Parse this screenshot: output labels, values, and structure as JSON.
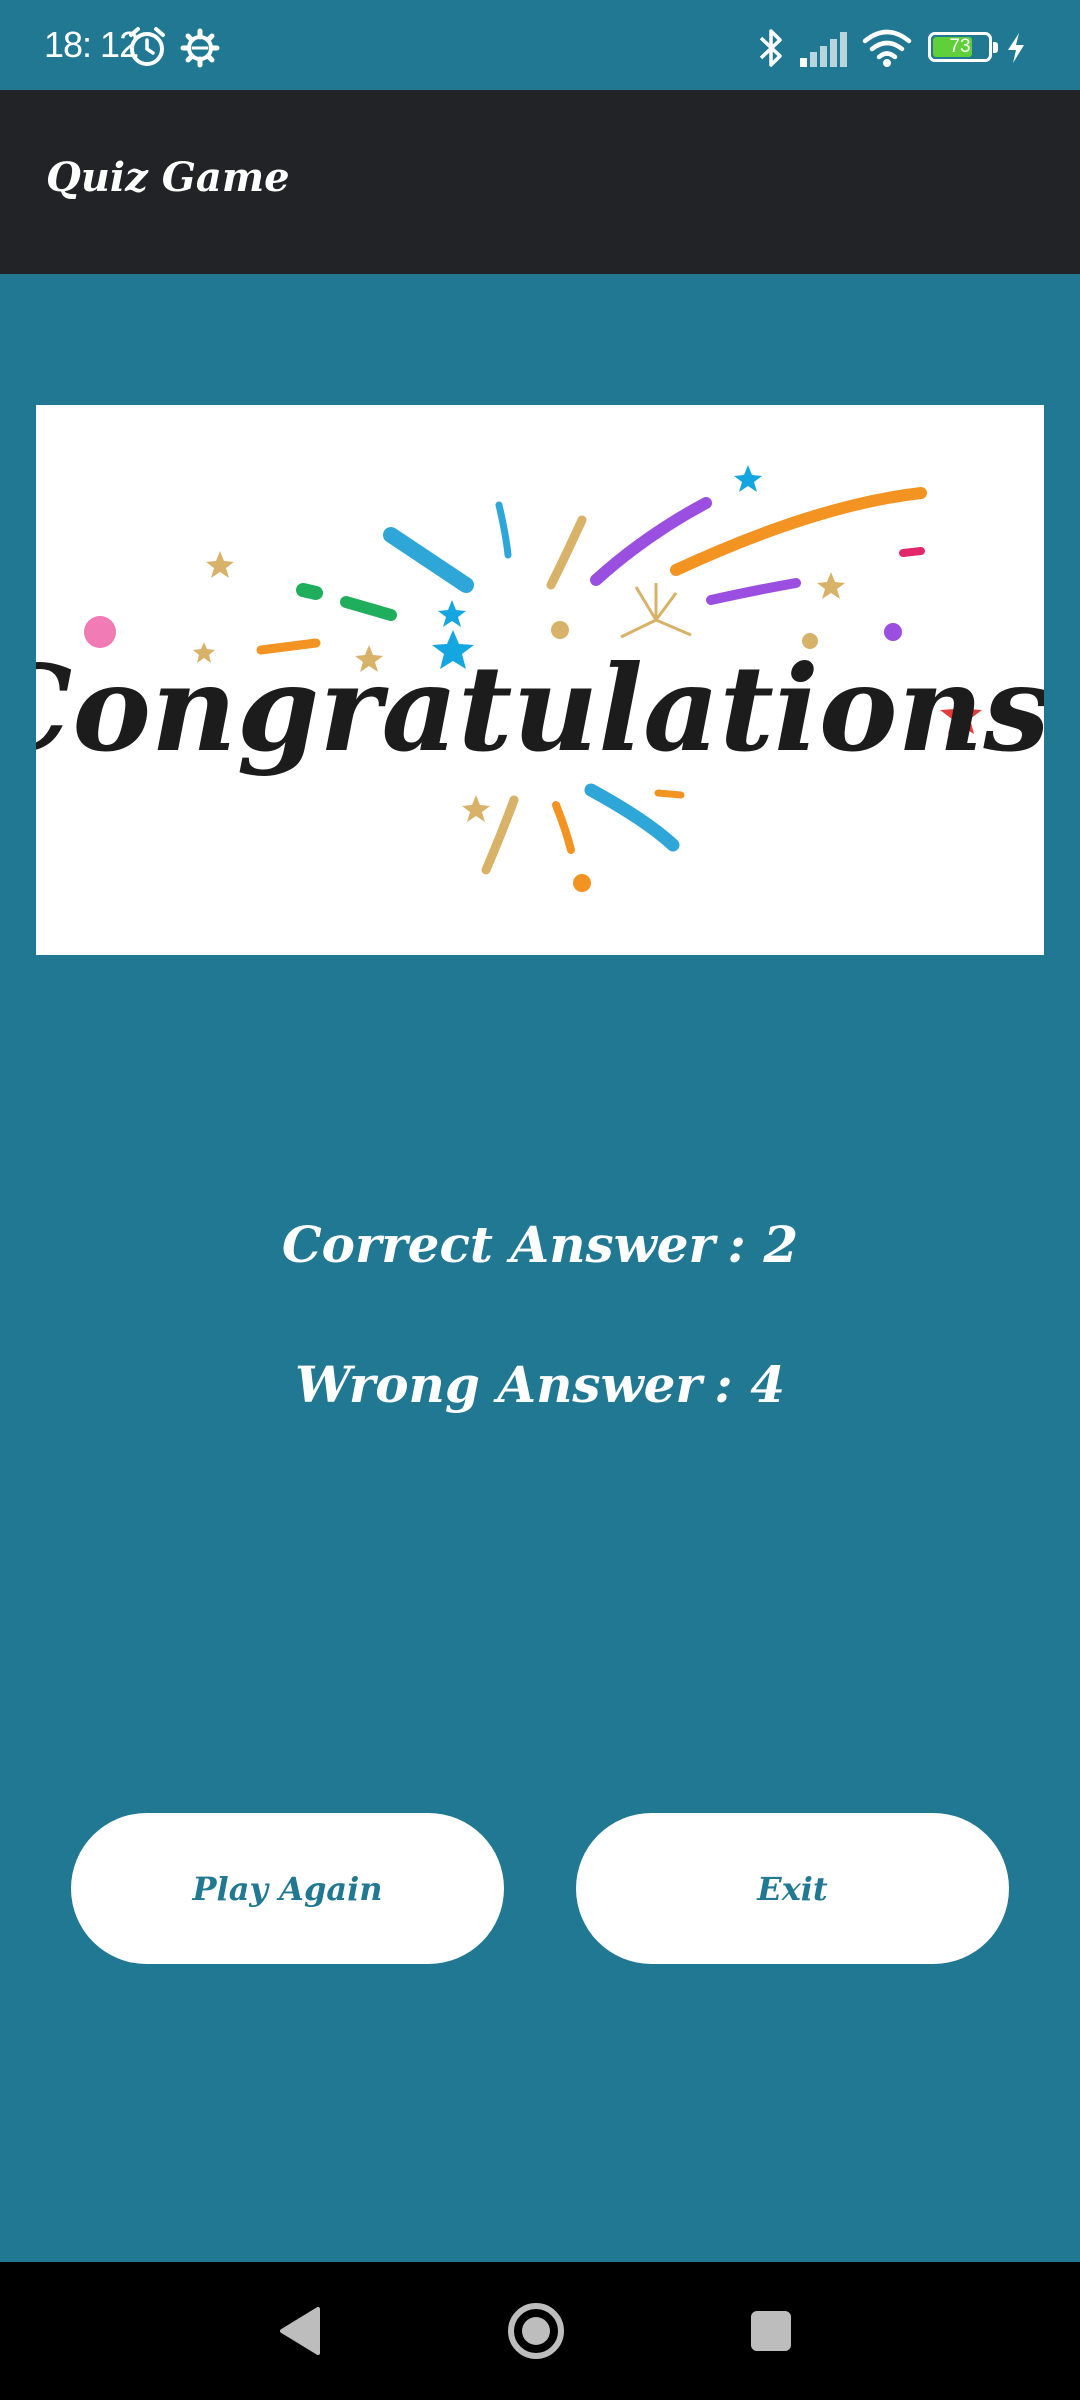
{
  "status_bar": {
    "time": "18: 12",
    "battery_level": "73",
    "battery_fraction": 0.73,
    "icons": [
      "alarm-icon",
      "settings-icon",
      "bluetooth-icon",
      "signal-icon",
      "wifi-icon",
      "battery-icon",
      "charging-icon"
    ]
  },
  "app_bar": {
    "title": "Quiz Game"
  },
  "banner": {
    "text": "Congratulations!"
  },
  "results": {
    "correct_label": "Correct Answer",
    "correct_value": "2",
    "wrong_label": "Wrong Answer",
    "wrong_value": "4",
    "separator": ":"
  },
  "buttons": {
    "play_again": "Play Again",
    "exit": "Exit"
  },
  "nav_bar": {
    "icons": [
      "back-icon",
      "home-icon",
      "recents-icon"
    ]
  },
  "colors": {
    "background": "#217893",
    "app_bar": "#222327",
    "button_bg": "#ffffff",
    "button_text": "#217893",
    "battery_fill": "#5fcf3a"
  }
}
